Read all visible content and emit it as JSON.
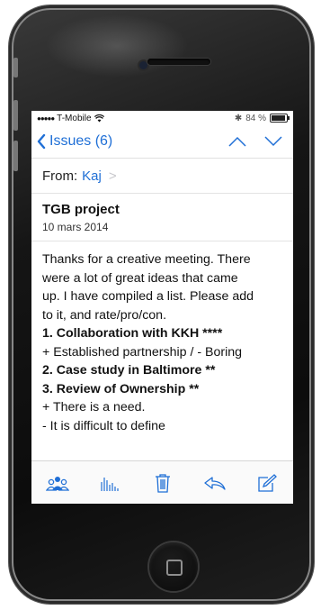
{
  "status_bar": {
    "signal": "●●●●●",
    "carrier": "T-Mobile",
    "bluetooth": "✱",
    "battery": "84 %"
  },
  "nav": {
    "back_label": "Issues (6)",
    "accent": "#1f6fd6"
  },
  "message": {
    "from_label": "From:",
    "from_name": "Kaj",
    "subject": "TGB project",
    "date": "10 mars 2014",
    "body": [
      {
        "text": "Thanks for a creative meeting. There",
        "bold": false
      },
      {
        "text": "were a lot of great ideas that came",
        "bold": false
      },
      {
        "text": "up. I have compiled a list. Please add",
        "bold": false
      },
      {
        "text": "to it, and rate/pro/con.",
        "bold": false
      },
      {
        "text": "1. Collaboration with KKH ****",
        "bold": true
      },
      {
        "text": "+ Established partnership / - Boring",
        "bold": false
      },
      {
        "text": "2. Case study in Baltimore **",
        "bold": true
      },
      {
        "text": "3. Review of Ownership **",
        "bold": true
      },
      {
        "text": "+ There is a need.",
        "bold": false
      },
      {
        "text": "- It is difficult to define",
        "bold": false
      }
    ]
  },
  "toolbar": {
    "icons": [
      "people-icon",
      "chart-icon",
      "trash-icon",
      "reply-icon",
      "compose-icon"
    ]
  }
}
